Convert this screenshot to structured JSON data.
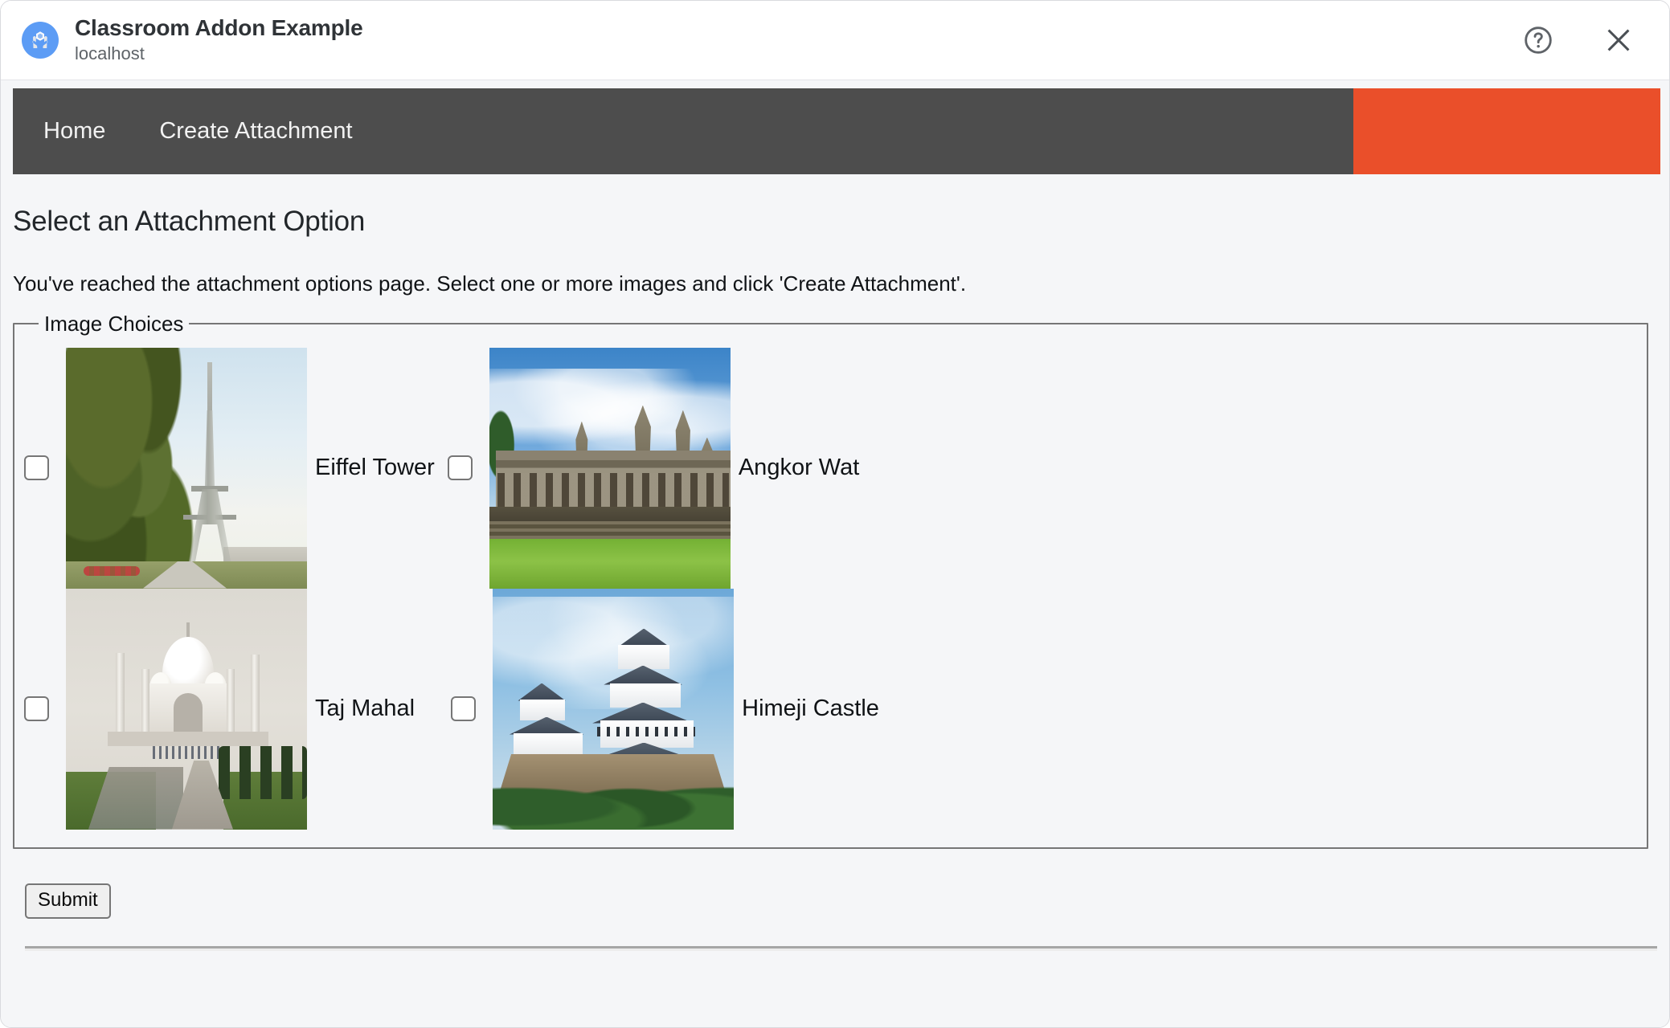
{
  "window": {
    "title": "Classroom Addon Example",
    "host": "localhost",
    "help_icon": "help-circle-icon",
    "close_icon": "close-icon",
    "app_icon": "addon-hands-hexagon-icon"
  },
  "navbar": {
    "links": [
      {
        "label": "Home",
        "name": "nav-home"
      },
      {
        "label": "Create Attachment",
        "name": "nav-create-attachment"
      }
    ],
    "background_color": "#4D4D4D",
    "accent_block_color": "#EA4F2A"
  },
  "content": {
    "heading": "Select an Attachment Option",
    "intro": "You've reached the attachment options page. Select one or more images and click 'Create Attachment'.",
    "fieldset_legend": "Image Choices",
    "submit_label": "Submit"
  },
  "image_choices": [
    {
      "label": "Eiffel Tower",
      "checked": false,
      "thumbnail": "eiffel-tower-photo"
    },
    {
      "label": "Angkor Wat",
      "checked": false,
      "thumbnail": "angkor-wat-photo"
    },
    {
      "label": "Taj Mahal",
      "checked": false,
      "thumbnail": "taj-mahal-photo"
    },
    {
      "label": "Himeji Castle",
      "checked": false,
      "thumbnail": "himeji-castle-photo"
    }
  ],
  "colors": {
    "page_background": "#F5F6F8",
    "navbar": "#4D4D4D",
    "accent_orange": "#EA4F2A",
    "text_primary": "#101316",
    "text_secondary": "#5E6368",
    "border": "#767676"
  }
}
